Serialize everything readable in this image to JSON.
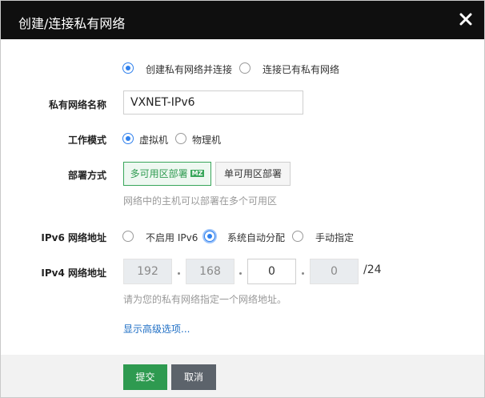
{
  "dialog": {
    "title": "创建/连接私有网络",
    "close_icon": "close-icon"
  },
  "mode_choice": {
    "options": [
      "创建私有网络并连接",
      "连接已有私有网络"
    ],
    "selected": 0
  },
  "name_field": {
    "label": "私有网络名称",
    "value": "VXNET-IPv6"
  },
  "work_mode": {
    "label": "工作模式",
    "options": [
      "虚拟机",
      "物理机"
    ],
    "selected": 0
  },
  "deploy": {
    "label": "部署方式",
    "options": [
      "多可用区部署",
      "单可用区部署"
    ],
    "tag": "MZ",
    "selected": 0,
    "hint": "网络中的主机可以部署在多个可用区"
  },
  "ipv6": {
    "label": "IPv6 网络地址",
    "options": [
      "不启用 IPv6",
      "系统自动分配",
      "手动指定"
    ],
    "selected": 1
  },
  "ipv4": {
    "label": "IPv4 网络地址",
    "octets": [
      "192",
      "168",
      "0",
      "0"
    ],
    "suffix": "/24",
    "hint": "请为您的私有网络指定一个网络地址。"
  },
  "advanced_link": "显示高级选项...",
  "footer": {
    "submit_label": "提交",
    "cancel_label": "取消"
  },
  "colors": {
    "titlebar": "#0f0f0f",
    "radio_selected": "#2f80ed",
    "primary_green": "#2e9a50",
    "link_blue": "#1f6fc5"
  }
}
